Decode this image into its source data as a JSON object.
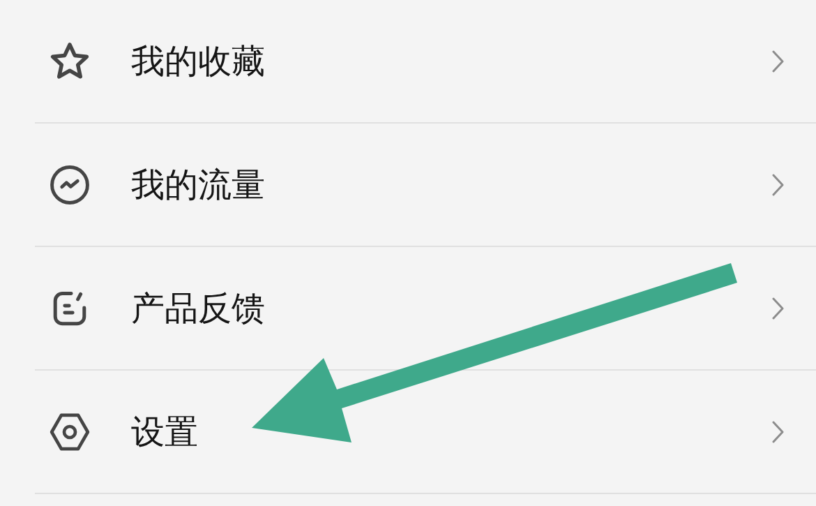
{
  "menu": {
    "items": [
      {
        "label": "我的收藏"
      },
      {
        "label": "我的流量"
      },
      {
        "label": "产品反馈"
      },
      {
        "label": "设置"
      }
    ]
  }
}
